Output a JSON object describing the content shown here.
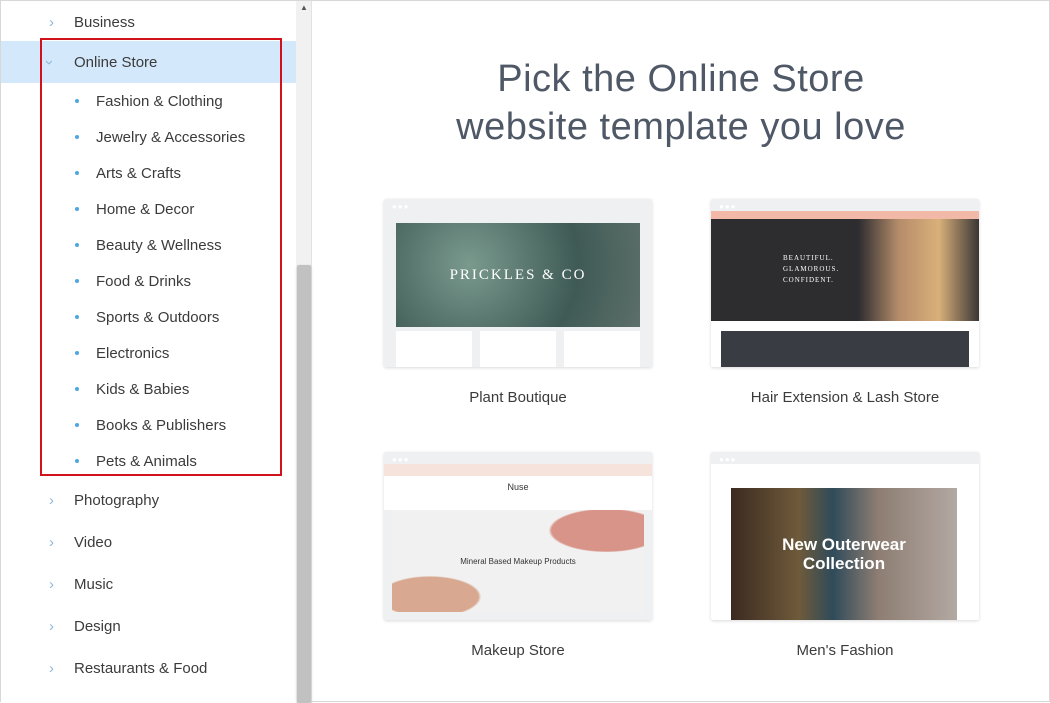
{
  "sidebar": {
    "top_categories": [
      {
        "label": "Business"
      }
    ],
    "active_category": {
      "label": "Online Store"
    },
    "subcategories": [
      {
        "label": "Fashion & Clothing"
      },
      {
        "label": "Jewelry & Accessories"
      },
      {
        "label": "Arts & Crafts"
      },
      {
        "label": "Home & Decor"
      },
      {
        "label": "Beauty & Wellness"
      },
      {
        "label": "Food & Drinks"
      },
      {
        "label": "Sports & Outdoors"
      },
      {
        "label": "Electronics"
      },
      {
        "label": "Kids & Babies"
      },
      {
        "label": "Books & Publishers"
      },
      {
        "label": "Pets & Animals"
      }
    ],
    "bottom_categories": [
      {
        "label": "Photography"
      },
      {
        "label": "Video"
      },
      {
        "label": "Music"
      },
      {
        "label": "Design"
      },
      {
        "label": "Restaurants & Food"
      }
    ],
    "highlight_color": "#d3e8fa",
    "annotation_color": "#d0131b"
  },
  "main": {
    "title_line1": "Pick the Online Store",
    "title_line2": "website template you love",
    "templates": [
      {
        "label": "Plant Boutique",
        "preview_text": "PRICKLES & CO"
      },
      {
        "label": "Hair Extension & Lash Store",
        "preview_text": "BEAUTIFUL. GLAMOROUS. CONFIDENT."
      },
      {
        "label": "Makeup Store",
        "preview_text": "Mineral Based Makeup Products",
        "preview_brand": "Nuse"
      },
      {
        "label": "Men's Fashion",
        "preview_text": "New Outerwear Collection"
      }
    ]
  }
}
